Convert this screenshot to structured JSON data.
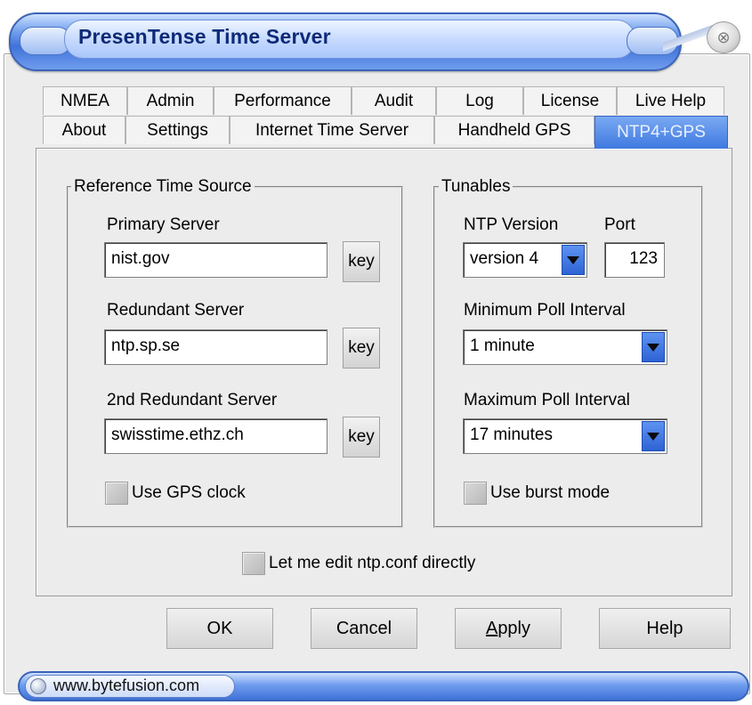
{
  "window": {
    "title": "PresenTense Time Server"
  },
  "tabs": {
    "row1": [
      "NMEA",
      "Admin",
      "Performance",
      "Audit",
      "Log",
      "License",
      "Live Help"
    ],
    "row2": [
      "About",
      "Settings",
      "Internet Time Server",
      "Handheld GPS",
      "NTP4+GPS"
    ],
    "active": "NTP4+GPS"
  },
  "reference": {
    "legend": "Reference Time Source",
    "primary_label": "Primary Server",
    "primary_value": "nist.gov",
    "redundant_label": "Redundant Server",
    "redundant_value": "ntp.sp.se",
    "redundant2_label": "2nd Redundant Server",
    "redundant2_value": "swisstime.ethz.ch",
    "key_label": "key",
    "gps_clock_label": "Use GPS clock"
  },
  "tunables": {
    "legend": "Tunables",
    "ntp_version_label": "NTP Version",
    "ntp_version_value": "version 4",
    "port_label": "Port",
    "port_value": "123",
    "min_poll_label": "Minimum Poll Interval",
    "min_poll_value": "1 minute",
    "max_poll_label": "Maximum Poll Interval",
    "max_poll_value": "17 minutes",
    "burst_label": "Use burst mode"
  },
  "edit_conf_label": "Let me edit ntp.conf directly",
  "buttons": {
    "ok": "OK",
    "cancel": "Cancel",
    "apply_rest": "pply",
    "apply_mnemonic": "A",
    "help": "Help"
  },
  "status": {
    "url": "www.bytefusion.com"
  },
  "icons": {
    "close": "close-icon",
    "globe": "globe-icon"
  },
  "colors": {
    "accent": "#3f79e0",
    "title_text": "#0e2a78"
  }
}
